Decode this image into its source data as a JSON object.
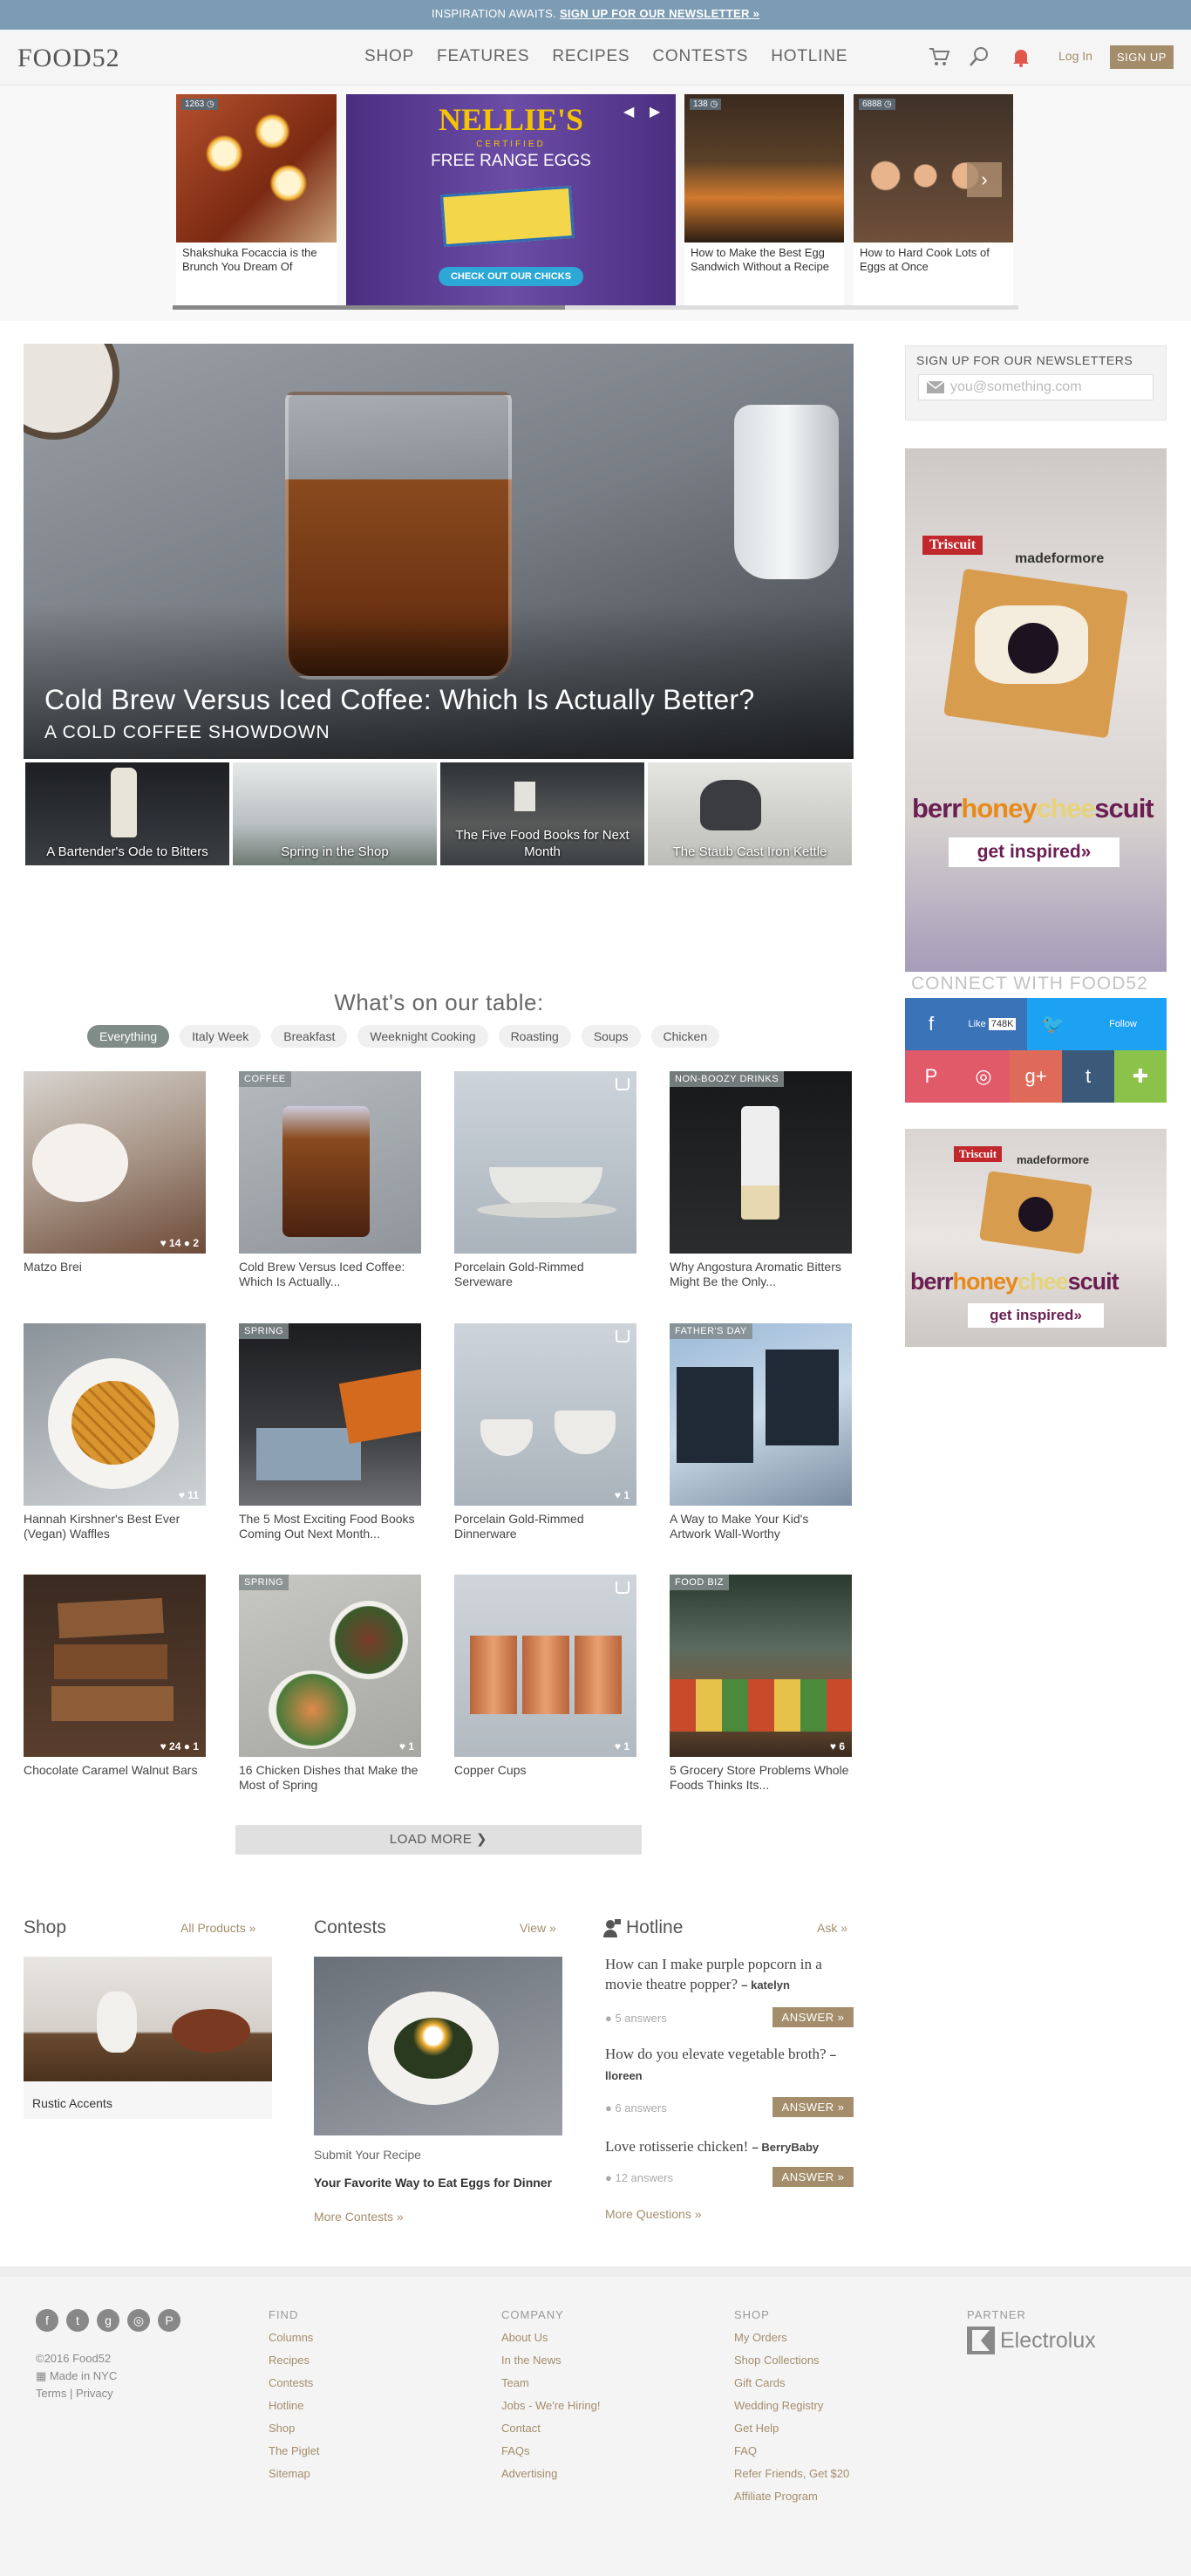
{
  "banner": {
    "text": "INSPIRATION AWAITS.",
    "link": "SIGN UP FOR OUR NEWSLETTER »"
  },
  "header": {
    "logo": "FOOD52",
    "nav": [
      "SHOP",
      "FEATURES",
      "RECIPES",
      "CONTESTS",
      "HOTLINE"
    ],
    "login": "Log In",
    "signup": "SIGN UP"
  },
  "carousel": {
    "items": [
      {
        "badge": "1263 ◷",
        "caption": "Shakshuka Focaccia is the Brunch You Dream Of"
      },
      {
        "ad_title": "NELLIE'S",
        "ad_certified": "CERTIFIED",
        "ad_sub": "FREE RANGE EGGS",
        "ad_cta": "CHECK OUT OUR CHICKS"
      },
      {
        "badge": "138 ◷",
        "caption": "How to Make the Best Egg Sandwich Without a Recipe"
      },
      {
        "badge": "6888 ◷",
        "caption": "How to Hard Cook Lots of Eggs at Once"
      }
    ]
  },
  "hero": {
    "title": "Cold Brew Versus Iced Coffee: Which Is Actually Better?",
    "subtitle": "A COLD COFFEE SHOWDOWN"
  },
  "sub_features": [
    "A Bartender's Ode to Bitters",
    "Spring in the Shop",
    "The Five Food Books for Next Month",
    "The Staub Cast Iron Kettle"
  ],
  "newsletter": {
    "title": "SIGN UP FOR OUR NEWSLETTERS",
    "placeholder": "you@something.com"
  },
  "ad": {
    "brand": "Triscuit",
    "made": "madeformore",
    "headline": [
      "berr",
      "honey",
      "chee",
      "scuit"
    ],
    "cta": "get inspired»"
  },
  "connect": {
    "title": "CONNECT WITH FOOD52",
    "fb_like": "Like",
    "fb_count": "748K",
    "tw_follow": "Follow"
  },
  "table": {
    "title": "What's on our table:",
    "filters": [
      "Everything",
      "Italy Week",
      "Breakfast",
      "Weeknight Cooking",
      "Roasting",
      "Soups",
      "Chicken"
    ],
    "tiles": [
      {
        "tag": "",
        "caption": "Matzo Brei",
        "count": "♥ 14  ● 2"
      },
      {
        "tag": "COFFEE",
        "caption": "Cold Brew Versus Iced Coffee: Which Is Actually...",
        "count": ""
      },
      {
        "tag": "",
        "caption": "Porcelain Gold-Rimmed Serveware",
        "count": ""
      },
      {
        "tag": "NON-BOOZY DRINKS",
        "caption": "Why Angostura Aromatic Bitters Might Be the Only...",
        "count": ""
      },
      {
        "tag": "",
        "caption": "Hannah Kirshner's Best Ever (Vegan) Waffles",
        "count": "♥ 11"
      },
      {
        "tag": "SPRING",
        "caption": "The 5 Most Exciting Food Books Coming Out Next Month...",
        "count": ""
      },
      {
        "tag": "",
        "caption": "Porcelain Gold-Rimmed Dinnerware",
        "count": "♥ 1"
      },
      {
        "tag": "FATHER'S DAY",
        "caption": "A Way to Make Your Kid's Artwork Wall-Worthy",
        "count": ""
      },
      {
        "tag": "",
        "caption": "Chocolate Caramel Walnut Bars",
        "count": "♥ 24  ● 1"
      },
      {
        "tag": "SPRING",
        "caption": "16 Chicken Dishes that Make the Most of Spring",
        "count": "♥ 1"
      },
      {
        "tag": "",
        "caption": "Copper Cups",
        "count": "♥ 1"
      },
      {
        "tag": "FOOD BIZ",
        "caption": "5 Grocery Store Problems Whole Foods Thinks Its...",
        "count": "♥ 6"
      }
    ],
    "load_more": "LOAD MORE ❯"
  },
  "shop": {
    "title": "Shop",
    "link": "All Products »",
    "item": "Rustic Accents"
  },
  "contests": {
    "title": "Contests",
    "link": "View »",
    "label": "Submit Your Recipe",
    "name": "Your Favorite Way to Eat Eggs for Dinner",
    "more": "More Contests »"
  },
  "hotline": {
    "title": "Hotline",
    "link": "Ask »",
    "questions": [
      {
        "q": "How can I make purple popcorn in a movie theatre popper?",
        "user": "– katelyn",
        "answers": "● 5 answers"
      },
      {
        "q": "How do you elevate vegetable broth?",
        "user": "– lloreen",
        "answers": "● 6 answers"
      },
      {
        "q": "Love rotisserie chicken!",
        "user": "– BerryBaby",
        "answers": "● 12 answers"
      }
    ],
    "answer_btn": "ANSWER »",
    "more": "More Questions »"
  },
  "footer": {
    "copyright": "©2016 Food52",
    "made": "Made in NYC",
    "legal": "Terms | Privacy",
    "find": {
      "title": "FIND",
      "items": [
        "Columns",
        "Recipes",
        "Contests",
        "Hotline",
        "Shop",
        "The Piglet",
        "Sitemap"
      ]
    },
    "company": {
      "title": "COMPANY",
      "items": [
        "About Us",
        "In the News",
        "Team",
        "Jobs - We're Hiring!",
        "Contact",
        "FAQs",
        "Advertising"
      ]
    },
    "shop": {
      "title": "SHOP",
      "items": [
        "My Orders",
        "Shop Collections",
        "Gift Cards",
        "Wedding Registry",
        "Get Help",
        "FAQ",
        "Refer Friends, Get $20",
        "Affiliate Program"
      ]
    },
    "partner": {
      "title": "PARTNER",
      "name": "Electrolux"
    }
  }
}
